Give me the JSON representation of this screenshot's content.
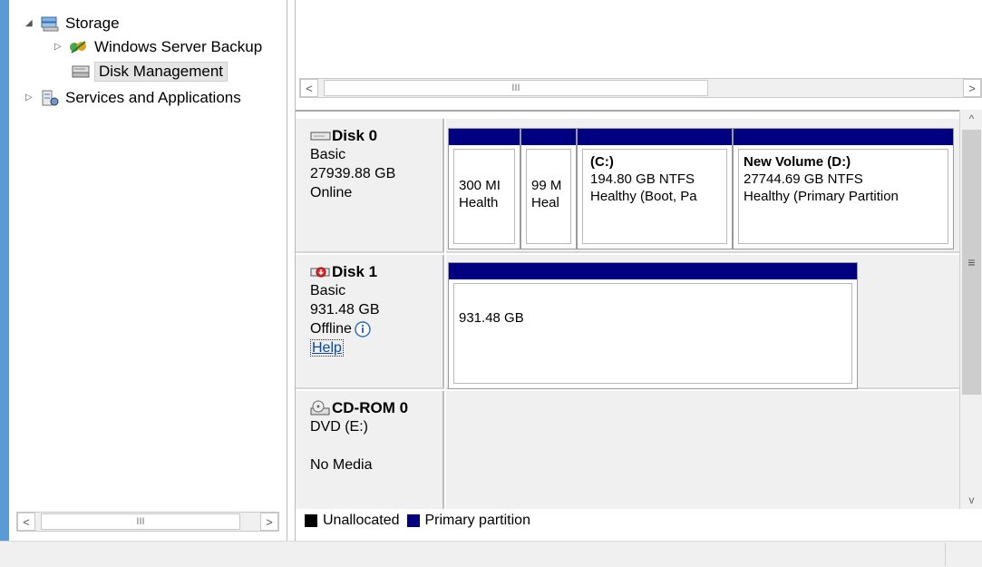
{
  "tree": {
    "items": [
      {
        "label": "Storage",
        "icon": "storage-icon",
        "twisty": "expanded"
      },
      {
        "label": "Windows Server Backup",
        "icon": "backup-icon",
        "twisty": "collapsed"
      },
      {
        "label": "Disk Management",
        "icon": "disk-management-icon",
        "twisty": "none",
        "selected": true
      },
      {
        "label": "Services and Applications",
        "icon": "services-icon",
        "twisty": "collapsed"
      }
    ],
    "hscroll_thumb": "III",
    "scroll_left": "<",
    "scroll_right": ">"
  },
  "upper": {
    "hscroll_thumb": "III",
    "scroll_left": "<",
    "scroll_right": ">"
  },
  "disks": [
    {
      "name": "Disk 0",
      "lines": [
        "Basic",
        "27939.88 GB",
        "Online"
      ],
      "partitions": [
        {
          "title": "",
          "line1": "300 MI",
          "line2": "Health"
        },
        {
          "title": "",
          "line1": "99 M",
          "line2": "Heal"
        },
        {
          "title": "(C:)",
          "line1": "194.80 GB NTFS",
          "line2": "Healthy (Boot, Pa"
        },
        {
          "title": "New Volume  (D:)",
          "line1": "27744.69 GB NTFS",
          "line2": "Healthy (Primary Partition"
        }
      ]
    },
    {
      "name": "Disk 1",
      "lines": [
        "Basic",
        "931.48 GB",
        "Offline"
      ],
      "help": "Help",
      "partitions": [
        {
          "title": "",
          "line1": "931.48 GB",
          "line2": ""
        }
      ]
    },
    {
      "name": "CD-ROM 0",
      "lines": [
        "DVD (E:)",
        "",
        "No Media"
      ]
    }
  ],
  "legend": {
    "unallocated": "Unallocated",
    "primary": "Primary partition",
    "unallocated_color": "#000000",
    "primary_color": "#000080"
  },
  "vscroll": {
    "up": "^",
    "down": "v",
    "grip": "≡"
  }
}
